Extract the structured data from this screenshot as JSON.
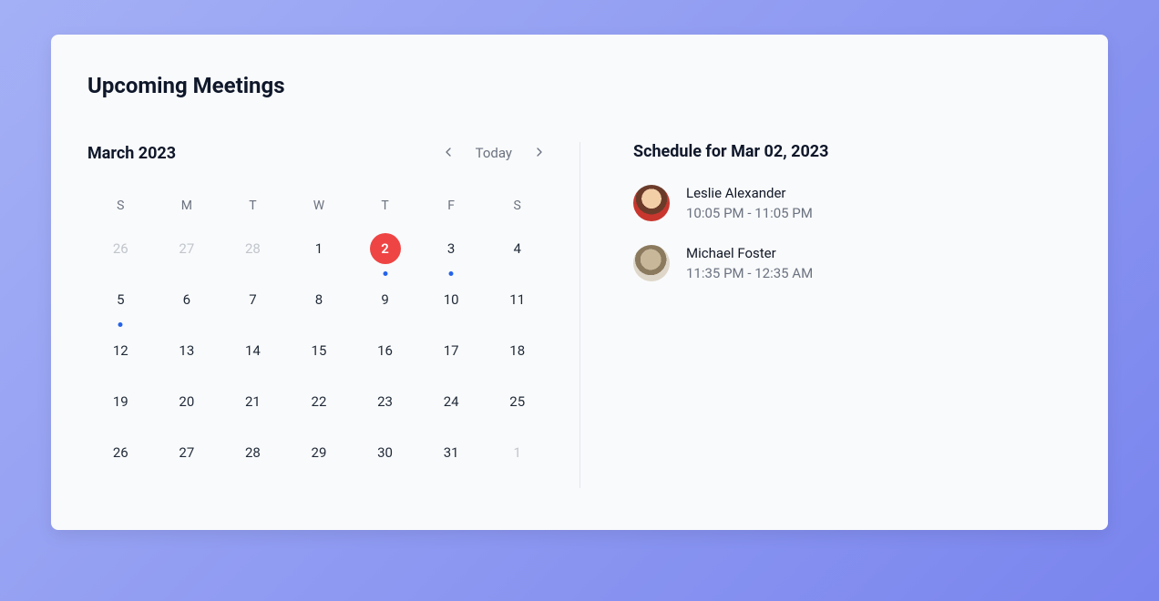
{
  "title": "Upcoming Meetings",
  "calendar": {
    "month_label": "March 2023",
    "today_label": "Today",
    "dow": [
      "S",
      "M",
      "T",
      "W",
      "T",
      "F",
      "S"
    ],
    "days": [
      {
        "n": 26,
        "outside": true,
        "selected": false,
        "dot": false
      },
      {
        "n": 27,
        "outside": true,
        "selected": false,
        "dot": false
      },
      {
        "n": 28,
        "outside": true,
        "selected": false,
        "dot": false
      },
      {
        "n": 1,
        "outside": false,
        "selected": false,
        "dot": false
      },
      {
        "n": 2,
        "outside": false,
        "selected": true,
        "dot": true
      },
      {
        "n": 3,
        "outside": false,
        "selected": false,
        "dot": true
      },
      {
        "n": 4,
        "outside": false,
        "selected": false,
        "dot": false
      },
      {
        "n": 5,
        "outside": false,
        "selected": false,
        "dot": true
      },
      {
        "n": 6,
        "outside": false,
        "selected": false,
        "dot": false
      },
      {
        "n": 7,
        "outside": false,
        "selected": false,
        "dot": false
      },
      {
        "n": 8,
        "outside": false,
        "selected": false,
        "dot": false
      },
      {
        "n": 9,
        "outside": false,
        "selected": false,
        "dot": false
      },
      {
        "n": 10,
        "outside": false,
        "selected": false,
        "dot": false
      },
      {
        "n": 11,
        "outside": false,
        "selected": false,
        "dot": false
      },
      {
        "n": 12,
        "outside": false,
        "selected": false,
        "dot": false
      },
      {
        "n": 13,
        "outside": false,
        "selected": false,
        "dot": false
      },
      {
        "n": 14,
        "outside": false,
        "selected": false,
        "dot": false
      },
      {
        "n": 15,
        "outside": false,
        "selected": false,
        "dot": false
      },
      {
        "n": 16,
        "outside": false,
        "selected": false,
        "dot": false
      },
      {
        "n": 17,
        "outside": false,
        "selected": false,
        "dot": false
      },
      {
        "n": 18,
        "outside": false,
        "selected": false,
        "dot": false
      },
      {
        "n": 19,
        "outside": false,
        "selected": false,
        "dot": false
      },
      {
        "n": 20,
        "outside": false,
        "selected": false,
        "dot": false
      },
      {
        "n": 21,
        "outside": false,
        "selected": false,
        "dot": false
      },
      {
        "n": 22,
        "outside": false,
        "selected": false,
        "dot": false
      },
      {
        "n": 23,
        "outside": false,
        "selected": false,
        "dot": false
      },
      {
        "n": 24,
        "outside": false,
        "selected": false,
        "dot": false
      },
      {
        "n": 25,
        "outside": false,
        "selected": false,
        "dot": false
      },
      {
        "n": 26,
        "outside": false,
        "selected": false,
        "dot": false
      },
      {
        "n": 27,
        "outside": false,
        "selected": false,
        "dot": false
      },
      {
        "n": 28,
        "outside": false,
        "selected": false,
        "dot": false
      },
      {
        "n": 29,
        "outside": false,
        "selected": false,
        "dot": false
      },
      {
        "n": 30,
        "outside": false,
        "selected": false,
        "dot": false
      },
      {
        "n": 31,
        "outside": false,
        "selected": false,
        "dot": false
      },
      {
        "n": 1,
        "outside": true,
        "selected": false,
        "dot": false
      }
    ]
  },
  "schedule": {
    "heading": "Schedule for Mar 02, 2023",
    "meetings": [
      {
        "name": "Leslie Alexander",
        "time": "10:05 PM - 11:05 PM",
        "avatar": "avatar-1"
      },
      {
        "name": "Michael Foster",
        "time": "11:35 PM - 12:35 AM",
        "avatar": "avatar-2"
      }
    ]
  }
}
